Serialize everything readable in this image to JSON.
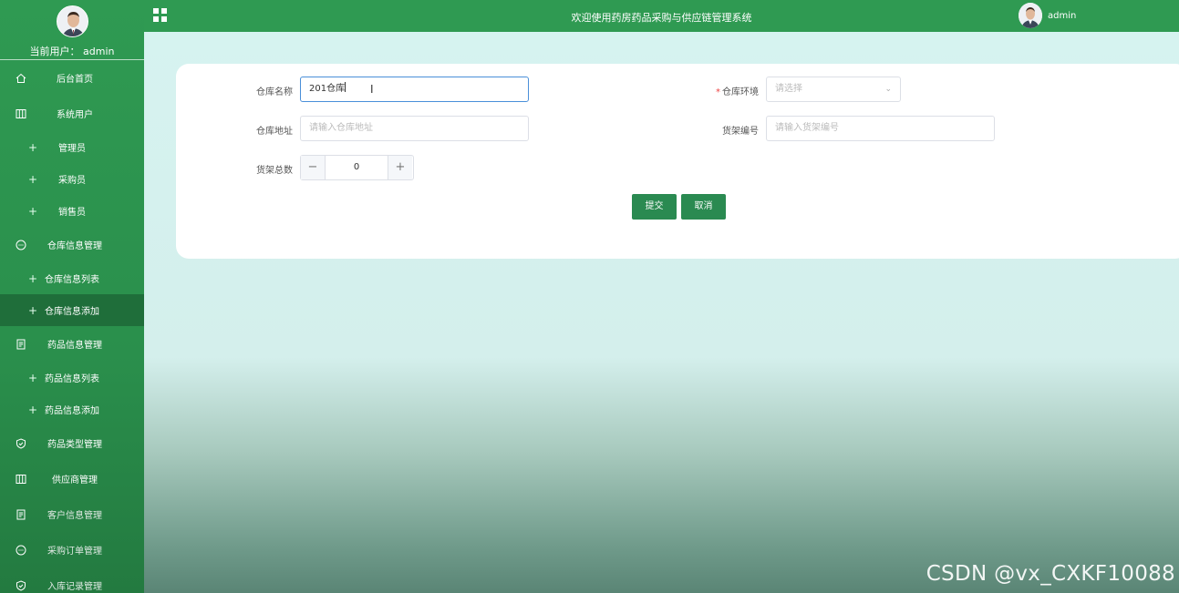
{
  "sidebar": {
    "user_label": "当前用户：  admin",
    "items": [
      {
        "label": "后台首页",
        "icon": "home-icon",
        "kind": "group"
      },
      {
        "label": "系统用户",
        "icon": "columns-icon",
        "kind": "group"
      },
      {
        "label": "管理员",
        "kind": "sub"
      },
      {
        "label": "采购员",
        "kind": "sub"
      },
      {
        "label": "销售员",
        "kind": "sub"
      },
      {
        "label": "仓库信息管理",
        "icon": "chat-icon",
        "kind": "group"
      },
      {
        "label": "仓库信息列表",
        "kind": "sub"
      },
      {
        "label": "仓库信息添加",
        "kind": "sub",
        "active": true
      },
      {
        "label": "药品信息管理",
        "icon": "document-icon",
        "kind": "group"
      },
      {
        "label": "药品信息列表",
        "kind": "sub"
      },
      {
        "label": "药品信息添加",
        "kind": "sub"
      },
      {
        "label": "药品类型管理",
        "icon": "shield-icon",
        "kind": "group"
      },
      {
        "label": "供应商管理",
        "icon": "columns-icon",
        "kind": "group"
      },
      {
        "label": "客户信息管理",
        "icon": "document-icon",
        "kind": "group"
      },
      {
        "label": "采购订单管理",
        "icon": "chat-icon",
        "kind": "group"
      },
      {
        "label": "入库记录管理",
        "icon": "shield-icon",
        "kind": "group"
      }
    ]
  },
  "topbar": {
    "title": "欢迎使用药房药品采购与供应链管理系统",
    "username": "admin"
  },
  "form": {
    "warehouse_name_label": "仓库名称",
    "warehouse_name_value": "201仓库",
    "environment_label": "仓库环境",
    "environment_placeholder": "请选择",
    "address_label": "仓库地址",
    "address_placeholder": "请输入仓库地址",
    "shelf_no_label": "货架编号",
    "shelf_no_placeholder": "请输入货架编号",
    "shelf_total_label": "货架总数",
    "shelf_total_value": "0",
    "minus_symbol": "−",
    "plus_symbol": "+",
    "submit_label": "提交",
    "cancel_label": "取消"
  },
  "watermark": "CSDN @vx_CXKF10088",
  "colors": {
    "sidebar": "#2f9a52",
    "active_item": "#1f6e3a",
    "button": "#2a8a51"
  }
}
